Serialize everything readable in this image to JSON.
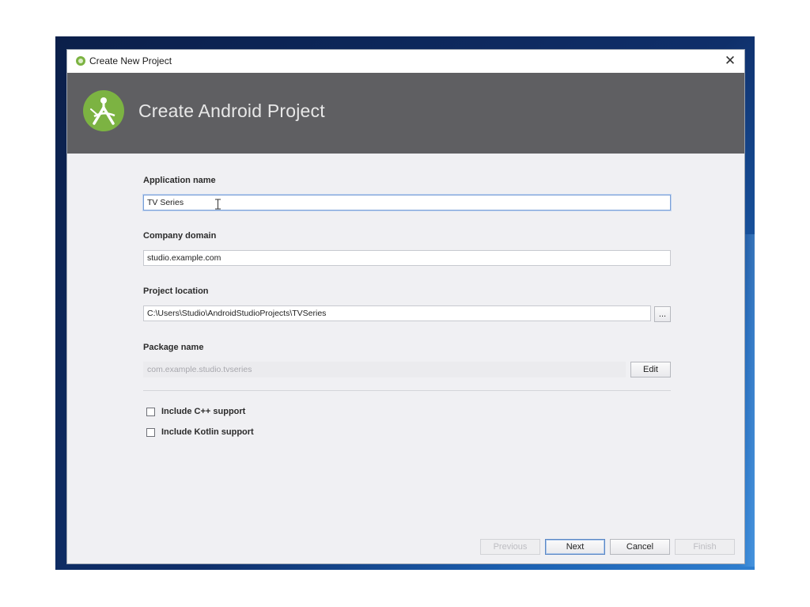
{
  "window": {
    "title": "Create New Project",
    "close_glyph": "✕"
  },
  "header": {
    "heading": "Create Android Project",
    "logo_icon": "android-studio-logo-icon"
  },
  "form": {
    "application_name": {
      "label": "Application name",
      "value": "TV Series"
    },
    "company_domain": {
      "label": "Company domain",
      "value": "studio.example.com"
    },
    "project_location": {
      "label": "Project location",
      "value": "C:\\Users\\Studio\\AndroidStudioProjects\\TVSeries",
      "browse_label": "..."
    },
    "package_name": {
      "label": "Package name",
      "value": "com.example.studio.tvseries",
      "edit_label": "Edit"
    },
    "options": [
      {
        "label": "Include C++ support",
        "checked": false
      },
      {
        "label": "Include Kotlin support",
        "checked": false
      }
    ]
  },
  "footer": {
    "previous_label": "Previous",
    "next_label": "Next",
    "cancel_label": "Cancel",
    "finish_label": "Finish"
  },
  "colors": {
    "header_bg": "#5f5f62",
    "android_green": "#7cb342",
    "dialog_bg": "#f0f0f3"
  }
}
